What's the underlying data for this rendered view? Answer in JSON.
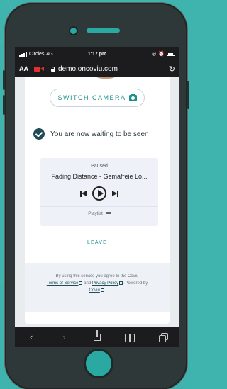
{
  "colors": {
    "background": "#3fb3ad",
    "phone_body": "#2e3838",
    "accent_teal": "#1e8f8a",
    "check_dark": "#1f4d57",
    "record_red": "#e0322b"
  },
  "status_bar": {
    "carrier": "Circles",
    "network": "4G",
    "time": "1:17 pm"
  },
  "url_bar": {
    "text_size_label": "AA",
    "recording_icon": "video-camera-icon",
    "url": "demo.oncoviu.com",
    "reload_icon": "reload-icon"
  },
  "content": {
    "switch_camera_label": "SWITCH CAMERA",
    "waiting_text": "You are now waiting to be seen",
    "player": {
      "status": "Paused",
      "track_title": "Fading Distance - Gemafreie Lo...",
      "playlist_label": "Playlist"
    },
    "leave_label": "LEAVE",
    "footer": {
      "prefix": "By using this service you agree to the Coviu",
      "terms_link": "Terms of Service",
      "and_text": "and",
      "privacy_link": "Privacy Policy",
      "powered_text": ". Powered by",
      "coviu_link": "Coviu",
      "suffix": "."
    }
  },
  "toolbar": {
    "back_glyph": "‹",
    "forward_glyph": "›"
  }
}
